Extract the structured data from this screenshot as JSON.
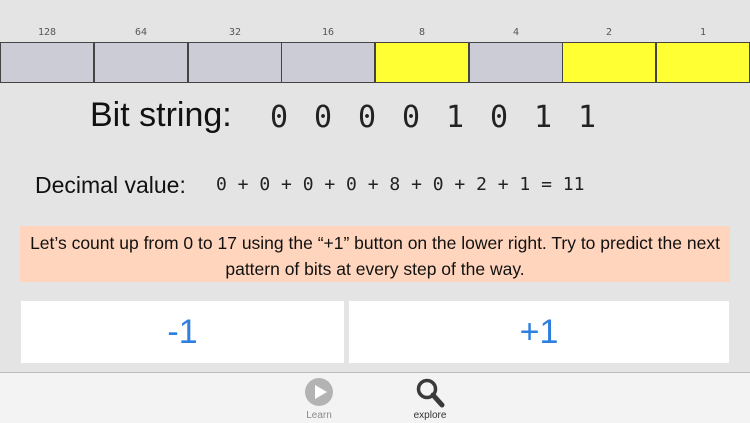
{
  "bits": [
    {
      "weight": "128",
      "value": 0
    },
    {
      "weight": "64",
      "value": 0
    },
    {
      "weight": "32",
      "value": 0
    },
    {
      "weight": "16",
      "value": 0
    },
    {
      "weight": "8",
      "value": 1
    },
    {
      "weight": "4",
      "value": 0
    },
    {
      "weight": "2",
      "value": 1
    },
    {
      "weight": "1",
      "value": 1
    }
  ],
  "bit_string": {
    "label": "Bit string:",
    "digits": [
      "0",
      "0",
      "0",
      "0",
      "1",
      "0",
      "1",
      "1"
    ]
  },
  "decimal": {
    "label": "Decimal value:",
    "expression": "0 + 0 + 0 + 0 + 8 + 0 + 2 + 1 = 11"
  },
  "instruction": "Let’s count up from 0 to 17 using the “+1” button on the lower right.  Try to predict the next pattern of bits at every step of the way.",
  "buttons": {
    "minus_label": "-1",
    "plus_label": "+1"
  },
  "tabs": {
    "learn": {
      "label": "Learn",
      "icon": "play-icon"
    },
    "explore": {
      "label": "explore",
      "icon": "magnifier-icon"
    }
  },
  "colors": {
    "bit_on": "#ffff33",
    "bit_off": "#ccccd6",
    "instruction_bg": "#ffd5bd",
    "button_text": "#2f7fe0"
  }
}
